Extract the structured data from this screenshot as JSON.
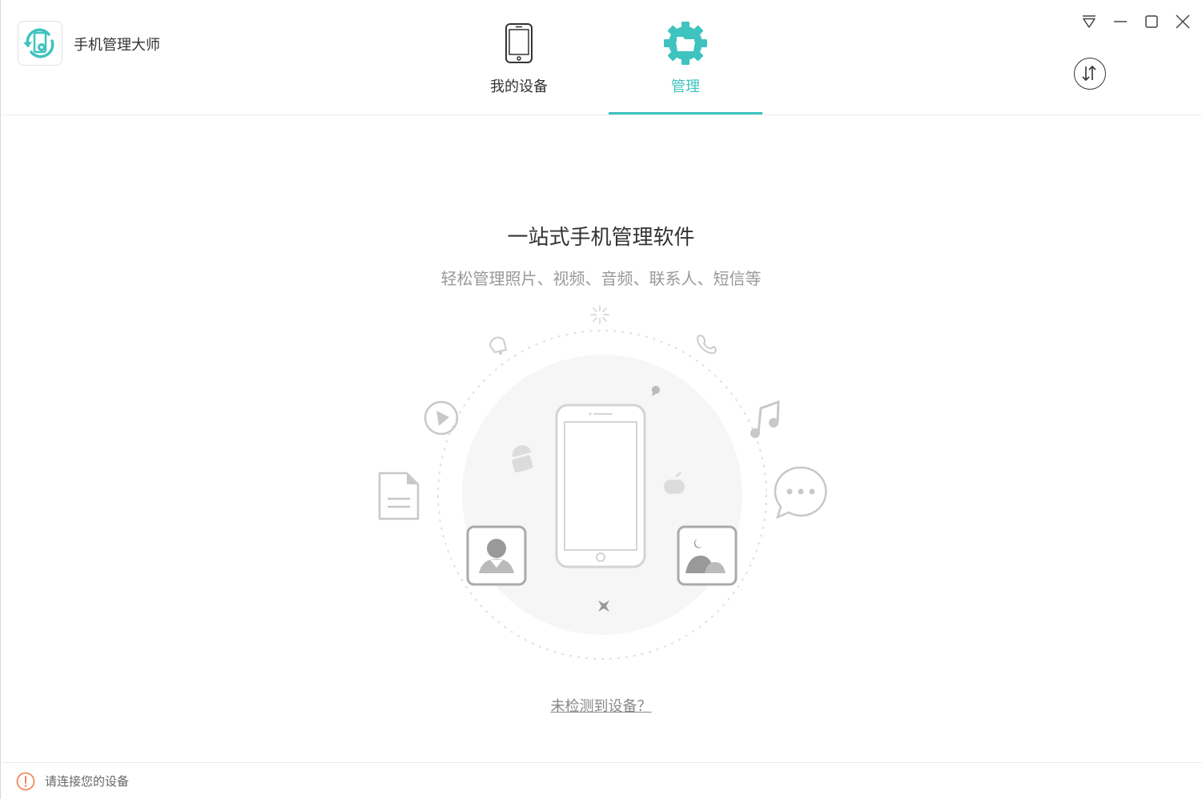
{
  "app": {
    "title": "手机管理大师",
    "logo_icon": "phone-sync-gear-icon"
  },
  "tabs": [
    {
      "label": "我的设备",
      "icon": "phone-icon",
      "active": false
    },
    {
      "label": "管理",
      "icon": "gear-folder-icon",
      "active": true
    }
  ],
  "window_controls": {
    "menu_icon": "dropdown-menu-icon",
    "minimize_icon": "minimize-icon",
    "maximize_icon": "maximize-icon",
    "close_icon": "close-icon"
  },
  "transfer_icon": "transfer-arrows-icon",
  "main": {
    "title": "一站式手机管理软件",
    "subtitle": "轻松管理照片、视频、音频、联系人、短信等",
    "no_device_link": "未检测到设备？"
  },
  "status": {
    "icon": "warning-icon",
    "text": "请连接您的设备"
  },
  "colors": {
    "accent": "#3ec3bf",
    "warning": "#f08a5d"
  }
}
